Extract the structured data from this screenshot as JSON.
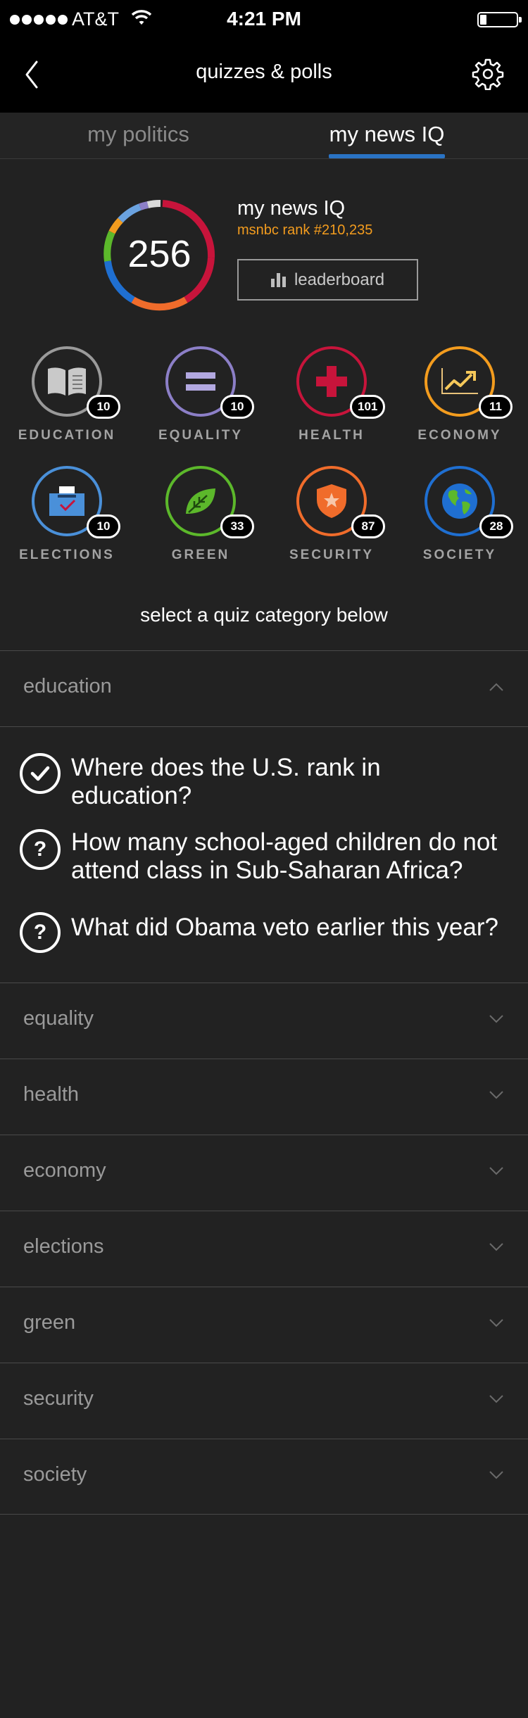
{
  "status_bar": {
    "carrier": "AT&T",
    "time": "4:21 PM"
  },
  "nav": {
    "title": "quizzes & polls",
    "back_icon": "chevron-left-icon",
    "settings_icon": "gear-icon"
  },
  "tabs": [
    {
      "label": "my politics",
      "active": false
    },
    {
      "label": "my news IQ",
      "active": true
    }
  ],
  "score": {
    "value": "256",
    "title": "my news IQ",
    "rank": "msnbc rank #210,235",
    "leaderboard_label": "leaderboard"
  },
  "categories": [
    {
      "label": "EDUCATION",
      "count": "10",
      "icon": "book-icon",
      "color": "#9a9a9a"
    },
    {
      "label": "EQUALITY",
      "count": "10",
      "icon": "equals-icon",
      "color": "#8c7fc7"
    },
    {
      "label": "HEALTH",
      "count": "101",
      "icon": "medical-cross-icon",
      "color": "#c7143b"
    },
    {
      "label": "ECONOMY",
      "count": "11",
      "icon": "trend-chart-icon",
      "color": "#f39c1e"
    },
    {
      "label": "ELECTIONS",
      "count": "10",
      "icon": "ballot-box-icon",
      "color": "#4a90d9"
    },
    {
      "label": "GREEN",
      "count": "33",
      "icon": "leaf-icon",
      "color": "#5cb82b"
    },
    {
      "label": "SECURITY",
      "count": "87",
      "icon": "shield-icon",
      "color": "#f06c2b"
    },
    {
      "label": "SOCIETY",
      "count": "28",
      "icon": "globe-icon",
      "color": "#1f6fd1"
    }
  ],
  "prompt": "select a quiz category below",
  "accordion": [
    {
      "label": "education",
      "expanded": true,
      "questions": [
        {
          "text": "Where does the U.S. rank in education?",
          "status": "answered"
        },
        {
          "text": "How many school-aged children do not attend class in Sub-Saharan Africa?",
          "status": "unanswered"
        },
        {
          "text": "What did Obama veto earlier this year?",
          "status": "unanswered"
        }
      ]
    },
    {
      "label": "equality",
      "expanded": false
    },
    {
      "label": "health",
      "expanded": false
    },
    {
      "label": "economy",
      "expanded": false
    },
    {
      "label": "elections",
      "expanded": false
    },
    {
      "label": "green",
      "expanded": false
    },
    {
      "label": "security",
      "expanded": false
    },
    {
      "label": "society",
      "expanded": false
    }
  ],
  "colors": {
    "accent_blue": "#2a73c4",
    "rank_orange": "#f39c1e",
    "background": "#222222"
  }
}
